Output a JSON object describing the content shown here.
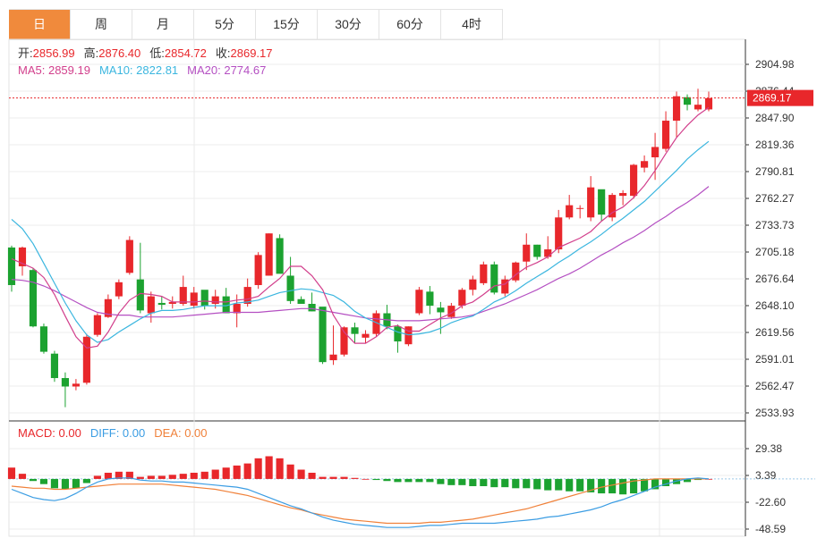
{
  "tabs": [
    "日",
    "周",
    "月",
    "5分",
    "15分",
    "30分",
    "60分",
    "4时"
  ],
  "active_tab": 0,
  "colors": {
    "up": "#e8272b",
    "down": "#1ca230",
    "ma5": "#d23f8c",
    "ma10": "#3bb6df",
    "ma20": "#b44fc2",
    "diff": "#3b9de3",
    "dea": "#f0813a",
    "macd": "#e8272b",
    "price_box": "#e8272b"
  },
  "ohlc_legend": [
    {
      "label": "开:",
      "value": "2856.99"
    },
    {
      "label": "高:",
      "value": "2876.40"
    },
    {
      "label": "低:",
      "value": "2854.72"
    },
    {
      "label": "收:",
      "value": "2869.17"
    }
  ],
  "ma_legend": [
    {
      "label": "MA5: ",
      "value": "2859.19",
      "key": "ma5"
    },
    {
      "label": "MA10: ",
      "value": "2822.81",
      "key": "ma10"
    },
    {
      "label": "MA20: ",
      "value": "2774.67",
      "key": "ma20"
    }
  ],
  "macd_legend": [
    {
      "label": "MACD: ",
      "value": "0.00",
      "key": "macd"
    },
    {
      "label": "DIFF: ",
      "value": "0.00",
      "key": "diff"
    },
    {
      "label": "DEA: ",
      "value": "0.00",
      "key": "dea"
    }
  ],
  "last_price": "2869.17",
  "chart_data": {
    "type": "candlestick",
    "price_axis": {
      "ticks": [
        "2904.98",
        "2876.44",
        "2847.90",
        "2819.36",
        "2790.81",
        "2762.27",
        "2733.73",
        "2705.18",
        "2676.64",
        "2648.10",
        "2619.56",
        "2591.01",
        "2562.47",
        "2533.93"
      ],
      "range": [
        2533.93,
        2904.98
      ]
    },
    "macd_axis": {
      "ticks": [
        "29.38",
        "3.39",
        "-22.60",
        "-48.59"
      ],
      "range": [
        -48.59,
        29.38
      ]
    },
    "candles": [
      [
        2710,
        2712,
        2663,
        2670
      ],
      [
        2690,
        2711,
        2680,
        2710
      ],
      [
        2686,
        2688,
        2625,
        2626
      ],
      [
        2626,
        2629,
        2597,
        2599
      ],
      [
        2597,
        2600,
        2567,
        2571
      ],
      [
        2571,
        2577,
        2540,
        2562
      ],
      [
        2562,
        2570,
        2558,
        2565
      ],
      [
        2566,
        2618,
        2564,
        2615
      ],
      [
        2617,
        2640,
        2615,
        2638
      ],
      [
        2636,
        2660,
        2635,
        2655
      ],
      [
        2658,
        2676,
        2655,
        2673
      ],
      [
        2683,
        2722,
        2681,
        2718
      ],
      [
        2676,
        2715,
        2640,
        2643
      ],
      [
        2640,
        2663,
        2630,
        2658
      ],
      [
        2651,
        2658,
        2644,
        2649
      ],
      [
        2650,
        2658,
        2645,
        2652
      ],
      [
        2650,
        2680,
        2648,
        2668
      ],
      [
        2648,
        2668,
        2645,
        2662
      ],
      [
        2665,
        2662,
        2644,
        2648
      ],
      [
        2650,
        2665,
        2645,
        2658
      ],
      [
        2658,
        2667,
        2643,
        2640
      ],
      [
        2640,
        2660,
        2625,
        2650
      ],
      [
        2650,
        2677,
        2647,
        2668
      ],
      [
        2670,
        2705,
        2666,
        2702
      ],
      [
        2680,
        2725,
        2680,
        2725
      ],
      [
        2720,
        2724,
        2688,
        2682
      ],
      [
        2680,
        2700,
        2650,
        2653
      ],
      [
        2655,
        2658,
        2650,
        2650
      ],
      [
        2650,
        2662,
        2642,
        2642
      ],
      [
        2647,
        2645,
        2586,
        2588
      ],
      [
        2590,
        2627,
        2585,
        2596
      ],
      [
        2596,
        2626,
        2594,
        2625
      ],
      [
        2625,
        2630,
        2608,
        2618
      ],
      [
        2614,
        2622,
        2608,
        2618
      ],
      [
        2618,
        2643,
        2615,
        2640
      ],
      [
        2640,
        2649,
        2623,
        2626
      ],
      [
        2626,
        2628,
        2598,
        2610
      ],
      [
        2607,
        2626,
        2605,
        2626
      ],
      [
        2640,
        2668,
        2638,
        2665
      ],
      [
        2663,
        2669,
        2639,
        2648
      ],
      [
        2646,
        2652,
        2618,
        2641
      ],
      [
        2636,
        2651,
        2634,
        2648
      ],
      [
        2648,
        2667,
        2645,
        2665
      ],
      [
        2665,
        2680,
        2659,
        2676
      ],
      [
        2672,
        2695,
        2670,
        2692
      ],
      [
        2692,
        2695,
        2660,
        2662
      ],
      [
        2661,
        2680,
        2658,
        2676
      ],
      [
        2675,
        2695,
        2673,
        2694
      ],
      [
        2695,
        2725,
        2686,
        2713
      ],
      [
        2713,
        2713,
        2697,
        2700
      ],
      [
        2700,
        2722,
        2698,
        2708
      ],
      [
        2708,
        2750,
        2704,
        2742
      ],
      [
        2742,
        2766,
        2740,
        2755
      ],
      [
        2752,
        2755,
        2741,
        2752
      ],
      [
        2742,
        2786,
        2738,
        2774
      ],
      [
        2772,
        2771,
        2738,
        2745
      ],
      [
        2742,
        2768,
        2738,
        2766
      ],
      [
        2765,
        2771,
        2755,
        2768
      ],
      [
        2765,
        2799,
        2762,
        2798
      ],
      [
        2795,
        2808,
        2790,
        2802
      ],
      [
        2806,
        2832,
        2782,
        2817
      ],
      [
        2815,
        2855,
        2812,
        2845
      ],
      [
        2845,
        2876,
        2827,
        2871
      ],
      [
        2870,
        2873,
        2856,
        2862
      ],
      [
        2857,
        2879,
        2855,
        2862
      ],
      [
        2857,
        2876,
        2855,
        2869
      ]
    ],
    "ma5": [
      2698,
      2693,
      2688,
      2678,
      2660,
      2637,
      2615,
      2603,
      2605,
      2620,
      2640,
      2654,
      2661,
      2660,
      2658,
      2652,
      2652,
      2652,
      2653,
      2652,
      2652,
      2654,
      2655,
      2658,
      2668,
      2677,
      2690,
      2690,
      2680,
      2665,
      2638,
      2620,
      2608,
      2608,
      2615,
      2625,
      2627,
      2621,
      2621,
      2628,
      2635,
      2640,
      2648,
      2652,
      2660,
      2669,
      2671,
      2681,
      2689,
      2694,
      2700,
      2710,
      2715,
      2720,
      2727,
      2738,
      2747,
      2753,
      2763,
      2776,
      2792,
      2810,
      2827,
      2840,
      2851,
      2859
    ],
    "ma10": [
      2740,
      2730,
      2714,
      2693,
      2672,
      2651,
      2632,
      2617,
      2609,
      2612,
      2620,
      2627,
      2634,
      2640,
      2643,
      2643,
      2644,
      2646,
      2648,
      2648,
      2648,
      2651,
      2652,
      2654,
      2658,
      2662,
      2664,
      2666,
      2665,
      2662,
      2659,
      2652,
      2642,
      2635,
      2630,
      2625,
      2620,
      2617,
      2618,
      2620,
      2624,
      2630,
      2634,
      2637,
      2644,
      2652,
      2657,
      2664,
      2672,
      2679,
      2686,
      2694,
      2701,
      2709,
      2716,
      2724,
      2733,
      2741,
      2750,
      2759,
      2770,
      2781,
      2792,
      2804,
      2814,
      2823
    ],
    "ma20": [
      2676,
      2675,
      2673,
      2669,
      2664,
      2658,
      2652,
      2646,
      2641,
      2639,
      2638,
      2638,
      2636,
      2636,
      2636,
      2636,
      2637,
      2638,
      2639,
      2640,
      2641,
      2641,
      2641,
      2641,
      2642,
      2643,
      2644,
      2645,
      2645,
      2643,
      2641,
      2639,
      2637,
      2635,
      2634,
      2633,
      2632,
      2632,
      2632,
      2633,
      2634,
      2635,
      2636,
      2638,
      2642,
      2646,
      2650,
      2655,
      2660,
      2665,
      2671,
      2677,
      2682,
      2688,
      2695,
      2702,
      2708,
      2715,
      2721,
      2728,
      2736,
      2743,
      2751,
      2758,
      2766,
      2775
    ],
    "macd": [
      11,
      5,
      -2,
      -5,
      -9,
      -10,
      -9,
      -4,
      3,
      6,
      7,
      7,
      2,
      3,
      3,
      4,
      5,
      6,
      7,
      9,
      11,
      13,
      15,
      20,
      22,
      20,
      14,
      9,
      6,
      2,
      2,
      2,
      1,
      0,
      -1,
      -2,
      -3,
      -3,
      -3,
      -3,
      -5,
      -6,
      -6,
      -7,
      -7,
      -8,
      -8,
      -9,
      -9,
      -10,
      -11,
      -11,
      -12,
      -12,
      -13,
      -14,
      -14,
      -15,
      -14,
      -12,
      -10,
      -7,
      -5,
      -3,
      -1,
      0
    ],
    "diff": [
      -10,
      -14,
      -18,
      -20,
      -21,
      -19,
      -14,
      -8,
      -3,
      0,
      1,
      1,
      -1,
      -2,
      -2,
      -3,
      -3,
      -4,
      -5,
      -6,
      -7,
      -8,
      -10,
      -14,
      -18,
      -22,
      -26,
      -29,
      -33,
      -37,
      -40,
      -42,
      -44,
      -45,
      -46,
      -47,
      -47,
      -47,
      -46,
      -45,
      -45,
      -44,
      -43,
      -43,
      -43,
      -43,
      -42,
      -41,
      -40,
      -39,
      -37,
      -36,
      -34,
      -32,
      -30,
      -27,
      -23,
      -20,
      -16,
      -12,
      -8,
      -5,
      -2,
      0,
      1,
      0
    ],
    "dea": [
      -7,
      -8,
      -9,
      -9,
      -10,
      -10,
      -9,
      -8,
      -7,
      -6,
      -5,
      -5,
      -5,
      -5,
      -5,
      -6,
      -7,
      -8,
      -9,
      -10,
      -12,
      -14,
      -16,
      -19,
      -22,
      -25,
      -28,
      -30,
      -33,
      -35,
      -37,
      -39,
      -40,
      -41,
      -42,
      -43,
      -43,
      -43,
      -43,
      -42,
      -42,
      -41,
      -40,
      -39,
      -37,
      -35,
      -33,
      -31,
      -29,
      -26,
      -23,
      -20,
      -17,
      -14,
      -11,
      -8,
      -6,
      -4,
      -2,
      -1,
      0,
      0,
      0,
      0,
      0,
      0
    ]
  }
}
